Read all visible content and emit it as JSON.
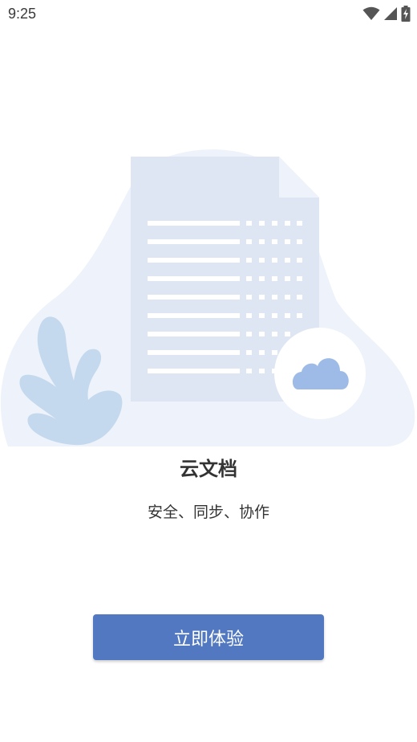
{
  "status_bar": {
    "time": "9:25",
    "icons": [
      "wifi-icon",
      "cellular-signal-icon",
      "battery-charging-icon"
    ]
  },
  "illustration": {
    "description_icons": [
      "document-icon",
      "cloud-icon",
      "plant-leaf-icon"
    ],
    "colors": {
      "blob": "#eef2fa",
      "document": "#dde6f2",
      "lines": "#ffffff",
      "cloud": "#9dbbe6",
      "leaf": "#c4d9ed"
    }
  },
  "onboarding": {
    "title": "云文档",
    "subtitle": "安全、同步、协作",
    "cta_label": "立即体验"
  },
  "colors": {
    "accent": "#5178c0",
    "text": "#333333"
  }
}
